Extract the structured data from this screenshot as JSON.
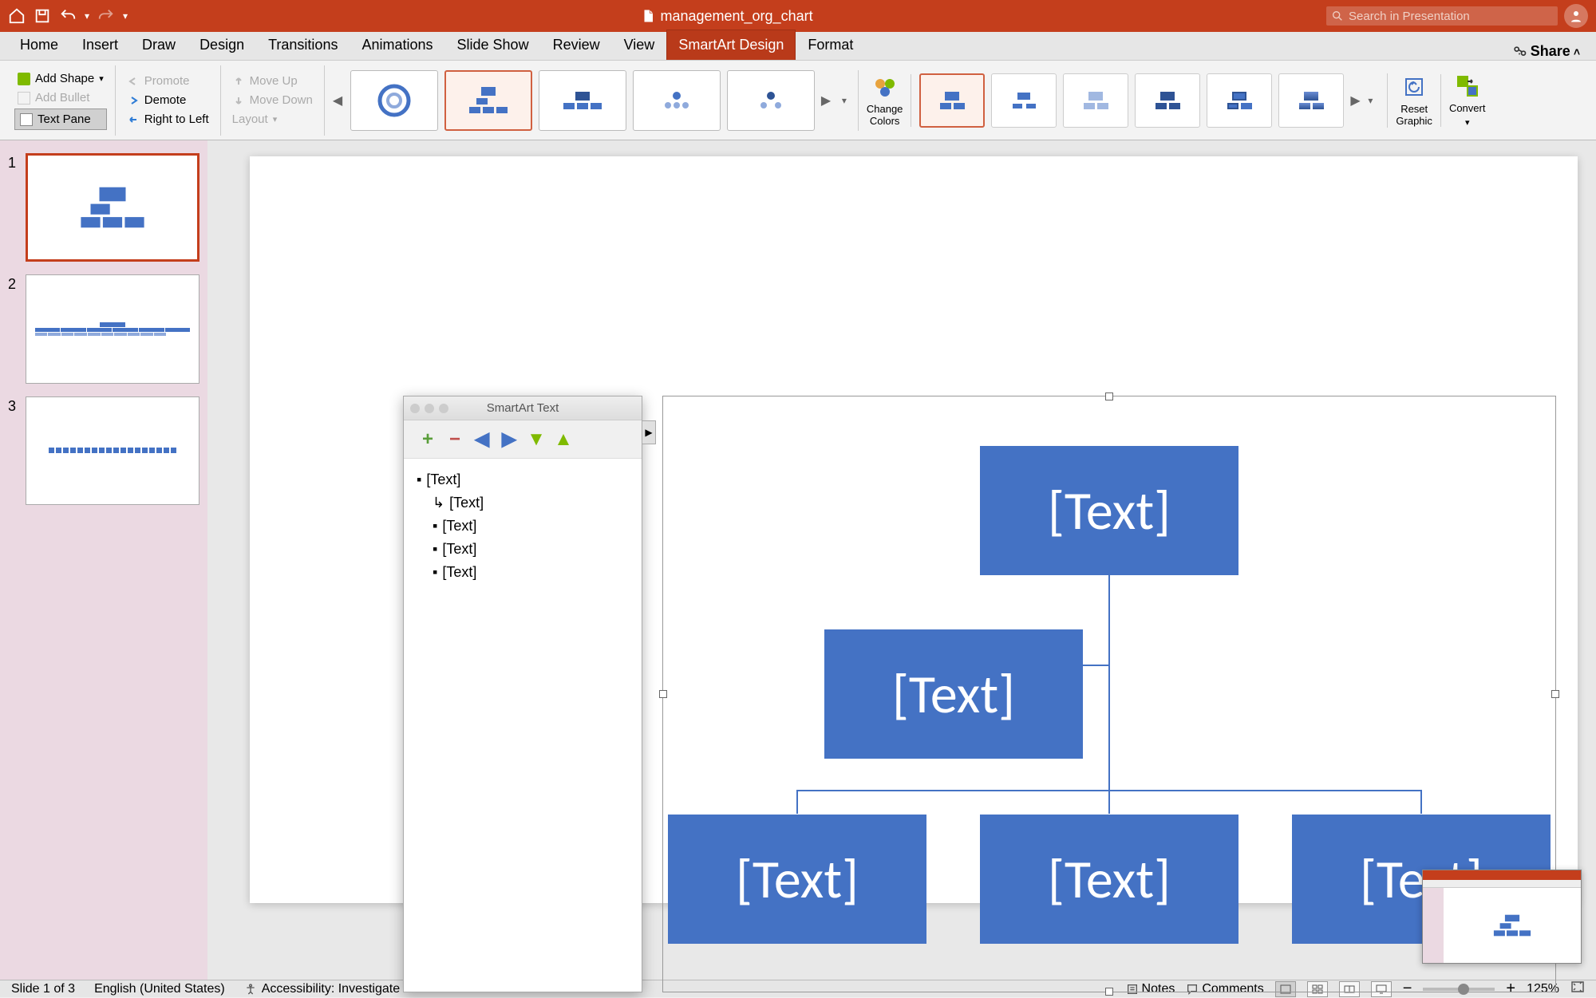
{
  "titlebar": {
    "doc_name": "management_org_chart",
    "search_placeholder": "Search in Presentation"
  },
  "tabs": {
    "items": [
      "Home",
      "Insert",
      "Draw",
      "Design",
      "Transitions",
      "Animations",
      "Slide Show",
      "Review",
      "View",
      "SmartArt Design",
      "Format"
    ],
    "active": "SmartArt Design",
    "share": "Share"
  },
  "ribbon": {
    "add_shape": "Add Shape",
    "add_bullet": "Add Bullet",
    "text_pane": "Text Pane",
    "promote": "Promote",
    "demote": "Demote",
    "right_to_left": "Right to Left",
    "move_up": "Move Up",
    "move_down": "Move Down",
    "layout": "Layout",
    "change_colors": "Change\nColors",
    "reset_graphic": "Reset\nGraphic",
    "convert": "Convert"
  },
  "text_pane": {
    "title": "SmartArt Text",
    "items": [
      {
        "text": "[Text]",
        "indent": 0
      },
      {
        "text": "[Text]",
        "indent": 1,
        "assistant": true
      },
      {
        "text": "[Text]",
        "indent": 1
      },
      {
        "text": "[Text]",
        "indent": 1
      },
      {
        "text": "[Text]",
        "indent": 1
      }
    ]
  },
  "smartart": {
    "boxes": {
      "top": "[Text]",
      "assistant": "[Text]",
      "child1": "[Text]",
      "child2": "[Text]",
      "child3": "[Text]"
    }
  },
  "slides": {
    "count": 3,
    "current": 1
  },
  "statusbar": {
    "slide_info": "Slide 1 of 3",
    "language": "English (United States)",
    "accessibility": "Accessibility: Investigate",
    "notes": "Notes",
    "comments": "Comments",
    "zoom": "125%"
  },
  "colors": {
    "accent": "#c43e1c",
    "box": "#4472c4"
  }
}
